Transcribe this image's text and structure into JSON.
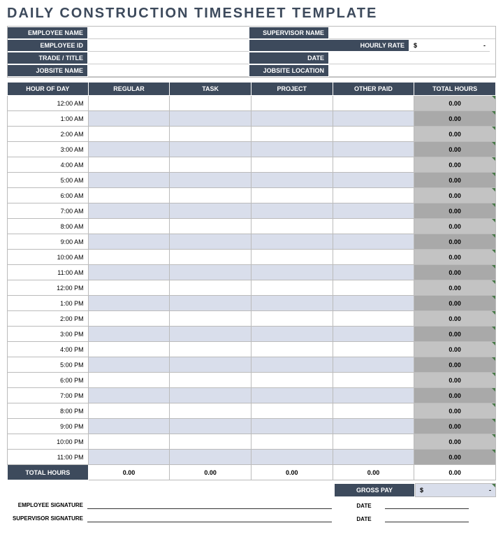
{
  "title": "DAILY CONSTRUCTION TIMESHEET TEMPLATE",
  "info": {
    "employee_name_label": "EMPLOYEE NAME",
    "employee_id_label": "EMPLOYEE ID",
    "trade_title_label": "TRADE / TITLE",
    "jobsite_name_label": "JOBSITE NAME",
    "supervisor_name_label": "SUPERVISOR NAME",
    "hourly_rate_label": "HOURLY RATE",
    "date_label": "DATE",
    "jobsite_location_label": "JOBSITE LOCATION",
    "hourly_rate_prefix": "$",
    "hourly_rate_value": "-",
    "employee_name": "",
    "employee_id": "",
    "trade_title": "",
    "jobsite_name": "",
    "supervisor_name": "",
    "date": "",
    "jobsite_location": ""
  },
  "columns": {
    "hour": "HOUR OF DAY",
    "regular": "REGULAR",
    "task": "TASK",
    "project": "PROJECT",
    "other": "OTHER PAID",
    "total": "TOTAL HOURS"
  },
  "hours": [
    "12:00 AM",
    "1:00 AM",
    "2:00 AM",
    "3:00 AM",
    "4:00 AM",
    "5:00 AM",
    "6:00 AM",
    "7:00 AM",
    "8:00 AM",
    "9:00 AM",
    "10:00 AM",
    "11:00 AM",
    "12:00 PM",
    "1:00 PM",
    "2:00 PM",
    "3:00 PM",
    "4:00 PM",
    "5:00 PM",
    "6:00 PM",
    "7:00 PM",
    "8:00 PM",
    "9:00 PM",
    "10:00 PM",
    "11:00 PM"
  ],
  "row_total_default": "0.00",
  "footer": {
    "total_label": "TOTAL HOURS",
    "regular_total": "0.00",
    "task_total": "0.00",
    "project_total": "0.00",
    "other_total": "0.00",
    "grand_total": "0.00"
  },
  "gross": {
    "label": "GROSS PAY",
    "prefix": "$",
    "value": "-"
  },
  "signatures": {
    "employee_label": "EMPLOYEE SIGNATURE",
    "supervisor_label": "SUPERVISOR SIGNATURE",
    "date_label": "DATE"
  }
}
